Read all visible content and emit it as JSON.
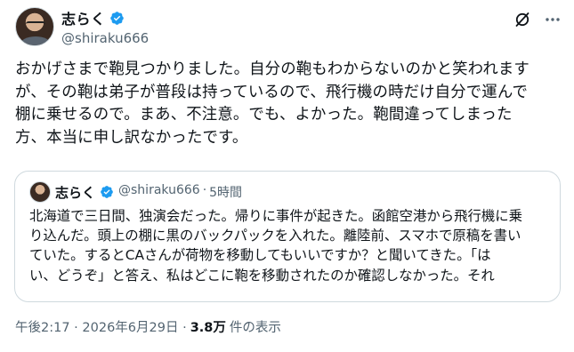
{
  "author": {
    "display_name": "志らく",
    "handle": "@shiraku666"
  },
  "icons": {
    "verified": "verified-badge-icon",
    "grok": "grok-icon",
    "more": "more-dots-icon"
  },
  "colors": {
    "verified_blue": "#1d9bf0",
    "secondary_text": "#536471",
    "border": "#cfd9de"
  },
  "tweet": {
    "text": "おかげさまで鞄見つかりました。自分の鞄もわからないのかと笑われます\nが、その鞄は弟子が普段は持っているので、飛行機の時だけ自分で運んで\n棚に乗せるので。まあ、不注意。でも、よかった。鞄間違ってしまった\n方、本当に申し訳なかったです。"
  },
  "quote": {
    "display_name": "志らく",
    "handle": "@shiraku666",
    "separator": "·",
    "time": "5時間",
    "text": "北海道で三日間、独演会だった。帰りに事件が起きた。函館空港から飛行機に乗\nり込んだ。頭上の棚に黒のバックパックを入れた。離陸前、スマホで原稿を書い\nていた。するとCAさんが荷物を移動してもいいですか？と聞いてきた。「は\nい、どうぞ」と答え、私はどこに鞄を移動されたのか確認しなかった。それ"
  },
  "footer": {
    "timestamp": "午後2:17 · 2026年6月29日 ·",
    "views_count": "3.8万",
    "views_label": "件の表示"
  }
}
